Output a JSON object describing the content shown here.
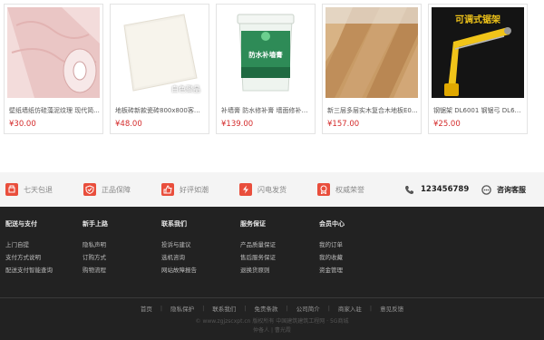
{
  "products": [
    {
      "title": "壁纸墙纸仿硅藻泥纹理 现代简...",
      "price": "¥30.00",
      "image": "pink-wallpaper-roll"
    },
    {
      "title": "地板砖新款瓷砖800x800客厅防...",
      "price": "¥48.00",
      "image": "white-tile",
      "overlay": "白色聚晶"
    },
    {
      "title": "补墙膏 防水修补膏 墙面修补膏...",
      "price": "¥139.00",
      "image": "paint-bucket",
      "overlay": "防水补墙膏"
    },
    {
      "title": "新三层多层实木复合木地板E0...",
      "price": "¥157.00",
      "image": "wood-floor"
    },
    {
      "title": "钢锯架 DL6001 钢锯弓 DL600...",
      "price": "¥25.00",
      "image": "hacksaw",
      "overlay": "可调式锯架"
    }
  ],
  "services": [
    {
      "label": "七天包退",
      "icon": "return-icon"
    },
    {
      "label": "正品保障",
      "icon": "shield-icon"
    },
    {
      "label": "好评如潮",
      "icon": "thumbs-up-icon"
    },
    {
      "label": "闪电发货",
      "icon": "lightning-icon"
    },
    {
      "label": "权威荣誉",
      "icon": "medal-icon"
    }
  ],
  "phone": "123456789",
  "support": "咨询客服",
  "footer_cols": [
    {
      "heading": "配送与支付",
      "items": [
        "上门自提",
        "支付方式说明",
        "配送支付智能查询"
      ]
    },
    {
      "heading": "新手上路",
      "items": [
        "隐私声明",
        "订购方式",
        "购物流程"
      ]
    },
    {
      "heading": "联系我们",
      "items": [
        "投诉与建议",
        "选机咨询",
        "网站故障报告"
      ]
    },
    {
      "heading": "服务保证",
      "items": [
        "产品质量保证",
        "售后服务保证",
        "退换货原则"
      ]
    },
    {
      "heading": "会员中心",
      "items": [
        "我的订单",
        "我的收藏",
        "资金管理"
      ]
    }
  ],
  "bottom_links": [
    "首页",
    "隐私保护",
    "联系我们",
    "免责条款",
    "公司简介",
    "商家入驻",
    "意见反馈"
  ],
  "copyright": "© www.zgjzscxpt.cn 版权所有 中国建筑建筑工程网 · 5G商城",
  "icp": "仲备人 | 曹光霞",
  "colors": {
    "accent": "#e94e3c",
    "price": "#d42b2b",
    "footer_bg": "#222222"
  }
}
